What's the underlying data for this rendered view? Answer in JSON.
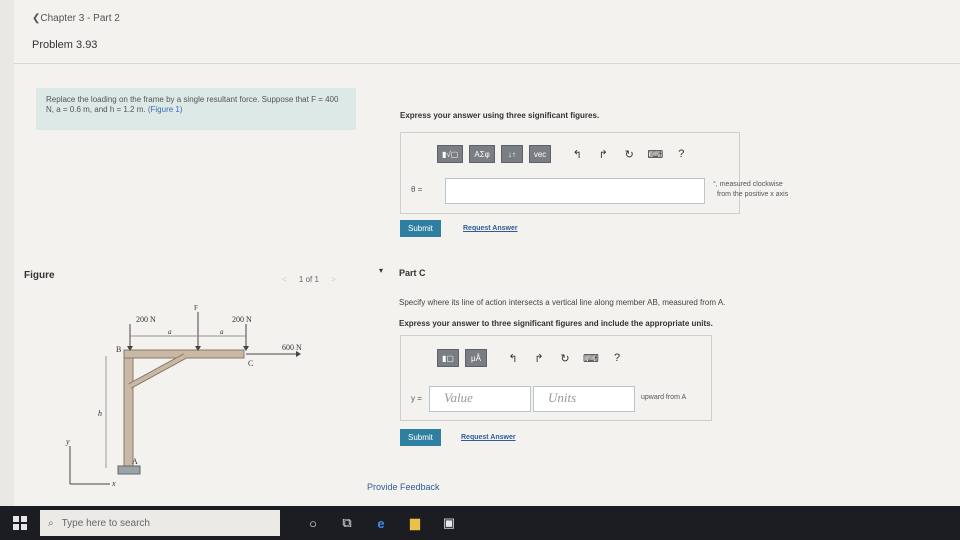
{
  "header": {
    "back_link": "❮Chapter 3 - Part 2",
    "problem_title": "Problem 3.93"
  },
  "prompt": {
    "text_1": "Replace the loading on the frame by a single resultant force. Suppose that",
    "text_2": "F = 400 N, a = 0.6 m, and h = 1.2 m. ",
    "figure_link": "(Figure 1)"
  },
  "part_b": {
    "instruction": "Express your answer using three significant figures.",
    "toolbar": {
      "btn_1": "▮√▢",
      "btn_2": "ΑΣφ",
      "btn_3": "↓↑",
      "btn_4": "vec",
      "undo": "↰",
      "redo": "↱",
      "reset": "↻",
      "keyboard": "⌨",
      "help": "?"
    },
    "var_label": "θ =",
    "unit_note_1": "°, measured clockwise",
    "unit_note_2": "from the positive x axis",
    "submit": "Submit",
    "request": "Request Answer"
  },
  "figure": {
    "title": "Figure",
    "nav": "1 of 1",
    "prev": "<",
    "next": ">",
    "labels": {
      "f200_left": "200 N",
      "f200_right": "200 N",
      "f_top": "F",
      "f600": "600 N",
      "a1": "a",
      "a2": "a",
      "b": "B",
      "c": "C",
      "a_point": "A",
      "h": "h",
      "y": "y",
      "x": "x"
    }
  },
  "part_c": {
    "toggle": "▾",
    "title": "Part C",
    "question": "Specify where its line of action intersects a vertical line along member AB, measured from A.",
    "instruction": "Express your answer to three significant figures and include the appropriate units.",
    "toolbar": {
      "btn_1": "▮▢",
      "btn_2": "μÅ",
      "undo": "↰",
      "redo": "↱",
      "reset": "↻",
      "keyboard": "⌨",
      "help": "?"
    },
    "var_label": "y =",
    "value_placeholder": "Value",
    "units_placeholder": "Units",
    "unit_note": "upward from A",
    "submit": "Submit",
    "request": "Request Answer"
  },
  "footer": {
    "feedback": "Provide Feedback"
  },
  "taskbar": {
    "search_placeholder": "Type here to search"
  }
}
